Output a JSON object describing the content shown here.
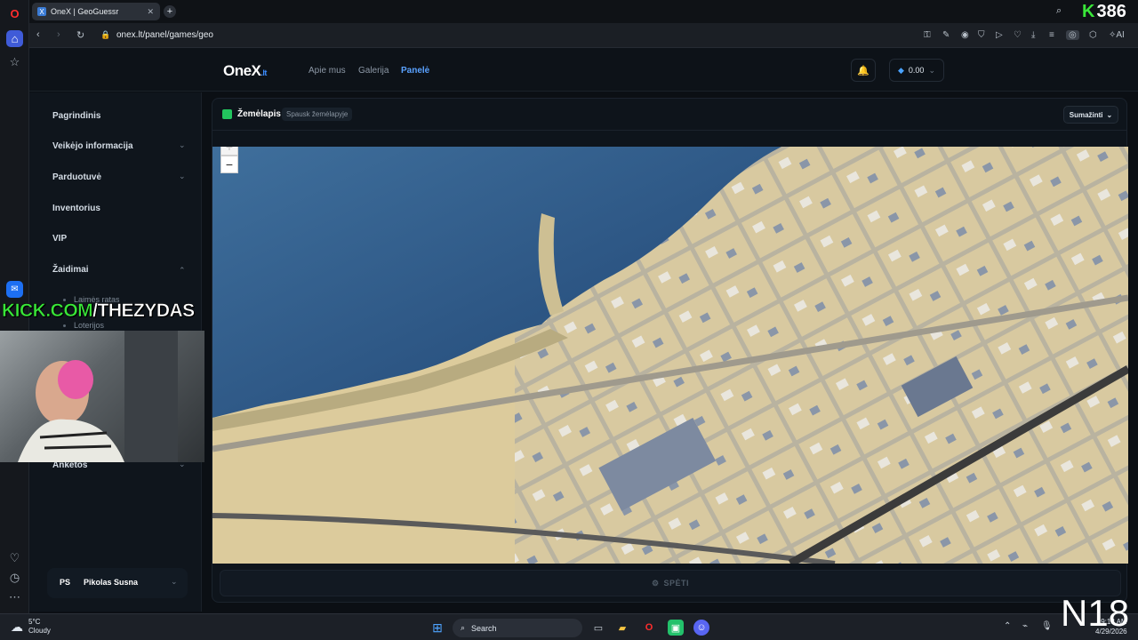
{
  "browser": {
    "tab_title": "OneX | GeoGuessr",
    "url": "onex.lt/panel/games/geo",
    "ai_label": "AI"
  },
  "site": {
    "logo_text": "OneX",
    "logo_suffix": ".lt",
    "nav": [
      {
        "label": "Apie mus",
        "active": false
      },
      {
        "label": "Galerija",
        "active": false
      },
      {
        "label": "Panelė",
        "active": true
      }
    ],
    "balance": "0.00"
  },
  "sidebar": {
    "items": [
      {
        "label": "Pagrindinis",
        "chevron": ""
      },
      {
        "label": "Veikėjo informacija",
        "chevron": "⌄"
      },
      {
        "label": "Parduotuvė",
        "chevron": "⌄"
      },
      {
        "label": "Inventorius",
        "chevron": ""
      },
      {
        "label": "VIP",
        "chevron": ""
      },
      {
        "label": "Žaidimai",
        "chevron": "⌃"
      },
      {
        "label": "Anketos",
        "chevron": "⌄"
      }
    ],
    "subitems": [
      "Laimės ratas",
      "Loterijos"
    ],
    "profile": {
      "initials": "PS",
      "name": "Pikolas Susna"
    }
  },
  "panel": {
    "title": "Žemėlapis",
    "hint": "Spausk žemėlapyje",
    "collapse_label": "Sumažinti",
    "zoom_in": "+",
    "zoom_out": "−",
    "submit_label": "SPĖTI"
  },
  "overlays": {
    "link_prefix": "KICK.COM",
    "link_suffix": "/THEZYDAS",
    "viewer_count": "386",
    "rating": "N18"
  },
  "taskbar": {
    "temperature": "5°C",
    "weather": "Cloudy",
    "search_placeholder": "Search",
    "time": "9:18 AM",
    "date": "4/29/2026"
  },
  "colors": {
    "accent": "#5aa2ff",
    "map_icon": "#22c55e",
    "kick_green": "#39e639"
  }
}
